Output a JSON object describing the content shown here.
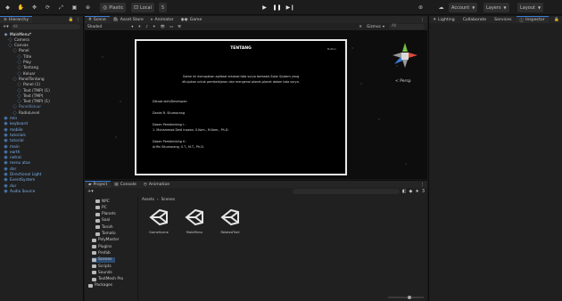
{
  "toolbar": {
    "account_label": "Account",
    "layers_label": "Layers",
    "layout_label": "Layout",
    "plastic_label": "Plastic",
    "local_label": "Local",
    "cloud_label": "5"
  },
  "hierarchy": {
    "tab_label": "Hierarchy",
    "search_placeholder": "All",
    "items": [
      {
        "label": "MainMenu*",
        "depth": 0
      },
      {
        "label": "Camera",
        "depth": 1
      },
      {
        "label": "Canvas",
        "depth": 1
      },
      {
        "label": "Panel",
        "depth": 2
      },
      {
        "label": "Title",
        "depth": 3
      },
      {
        "label": "Play",
        "depth": 3
      },
      {
        "label": "Tentang",
        "depth": 3
      },
      {
        "label": "Keluar",
        "depth": 3
      },
      {
        "label": "PanelTentang",
        "depth": 2
      },
      {
        "label": "Panel (1)",
        "depth": 3
      },
      {
        "label": "Text (TMP) (1)",
        "depth": 3
      },
      {
        "label": "Text (TMP)",
        "depth": 3
      },
      {
        "label": "Text (TMP) (1)",
        "depth": 3
      },
      {
        "label": "PanelKeluar",
        "depth": 2
      },
      {
        "label": "RadioLevel",
        "depth": 2
      },
      {
        "label": "min",
        "depth": 0
      },
      {
        "label": "keyboard",
        "depth": 0
      },
      {
        "label": "mobile",
        "depth": 0
      },
      {
        "label": "tutorials",
        "depth": 0
      },
      {
        "label": "tutorial",
        "depth": 0
      },
      {
        "label": "main",
        "depth": 0
      },
      {
        "label": "earth",
        "depth": 0
      },
      {
        "label": "netral",
        "depth": 0
      },
      {
        "label": "menu atas",
        "depth": 0
      },
      {
        "label": "dnr",
        "depth": 0
      },
      {
        "label": "Directional Light",
        "depth": 0
      },
      {
        "label": "EventSystem",
        "depth": 0
      },
      {
        "label": "dur",
        "depth": 0
      },
      {
        "label": "Audio Source",
        "depth": 0
      }
    ]
  },
  "scene_tabs": {
    "scene": "Scene",
    "asset_store": "Asset Store",
    "animator": "Animator",
    "game": "Game",
    "shading_mode": "Shaded",
    "gizmos_label": "Gizmos",
    "search_placeholder": "All"
  },
  "scene_view": {
    "persp_label": "< Persp",
    "panel_title": "TENTANG",
    "panel_corner": "Button",
    "intro_line1": "Game ini merupakan aplikasi edukasi tata surya berbasis Solar System yang",
    "intro_line2": "ditujukan untuk pembelajaran dan mengenal planet-planet dalam tata surya.",
    "author_label": "Dibuat oleh/Developer:",
    "author_name": "Daniel R. Situmorang",
    "advisor1_label": "Dosen Pembimbing I :",
    "advisor1_name": "1. Muhammad Dedi Irawan, S.Kom., M.Kom., Ph.D.",
    "advisor2_label": "Dosen Pembimbing II :",
    "advisor2_name": "Arifin Situmorang, S.T., M.T., Ph.D."
  },
  "inspector_tabs": {
    "inspector": "Inspector",
    "services": "Services",
    "collaborate": "Collaborate",
    "lighting": "Lighting"
  },
  "project": {
    "tab_project": "Project",
    "tab_console": "Console",
    "tab_animation": "Animation",
    "breadcrumb_root": "Assets",
    "breadcrumb_current": "Scenes",
    "folders": [
      {
        "label": "NPC",
        "depth": 1
      },
      {
        "label": "PC",
        "depth": 1
      },
      {
        "label": "Planets",
        "depth": 1
      },
      {
        "label": "Soal",
        "depth": 1
      },
      {
        "label": "Tanah",
        "depth": 1
      },
      {
        "label": "Tomato",
        "depth": 1
      },
      {
        "label": "PolyMaster",
        "depth": 0
      },
      {
        "label": "Plugins",
        "depth": 0
      },
      {
        "label": "Prefab",
        "depth": 0
      },
      {
        "label": "Scenes",
        "depth": 0
      },
      {
        "label": "Scripts",
        "depth": 0
      },
      {
        "label": "Sounds",
        "depth": 0
      },
      {
        "label": "TextMesh Pro",
        "depth": 0
      },
      {
        "label": "Packages",
        "depth": -1
      }
    ],
    "assets": [
      {
        "label": "GameScene"
      },
      {
        "label": "MainMenu"
      },
      {
        "label": "RelatedTrail"
      }
    ],
    "count_badge": "3"
  }
}
